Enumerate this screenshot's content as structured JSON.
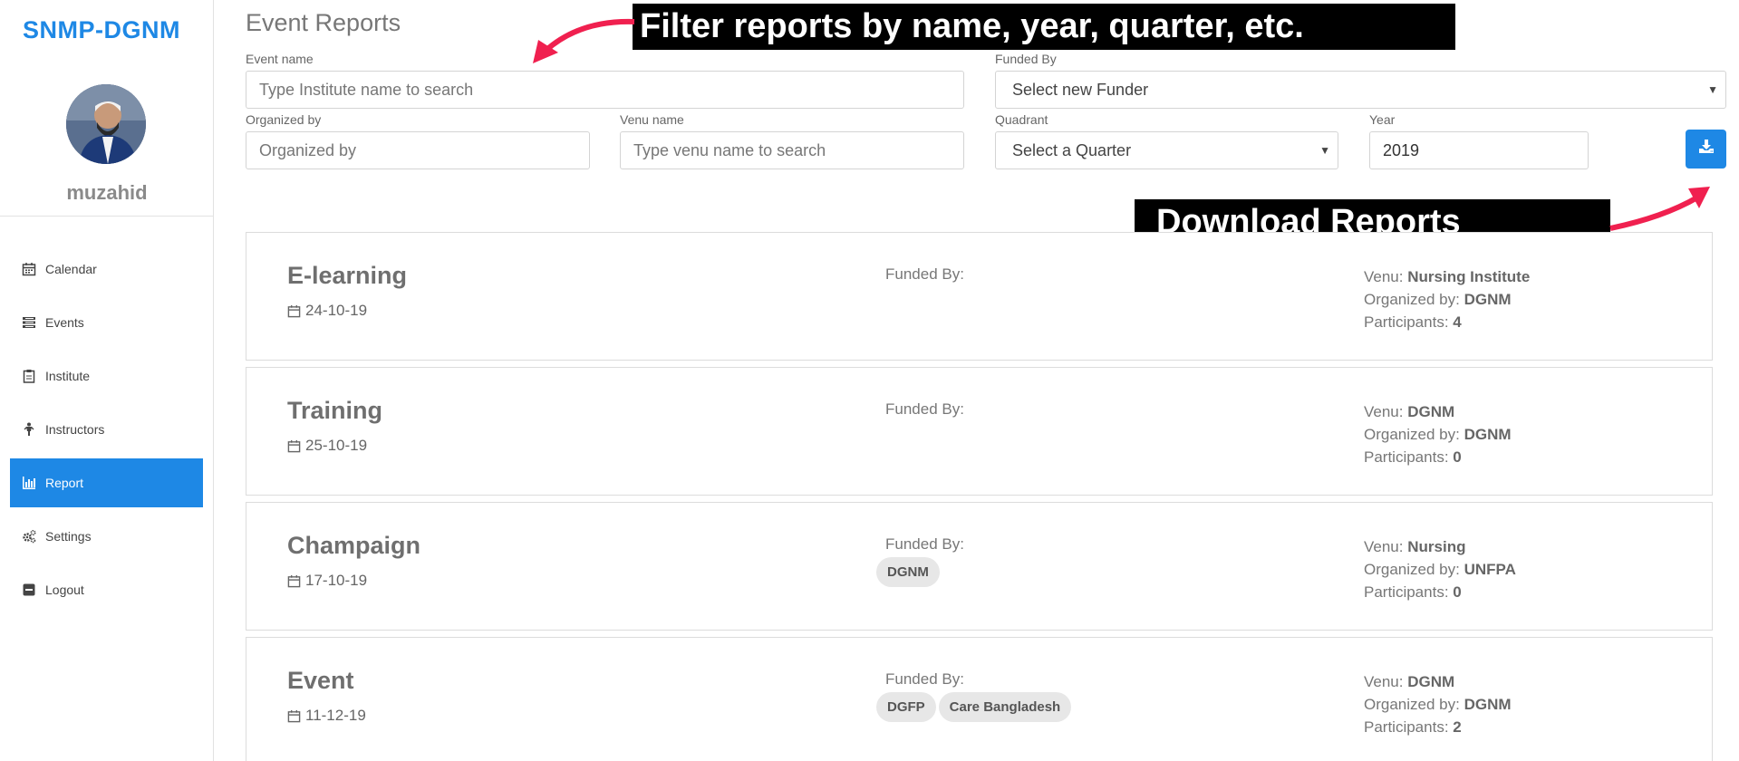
{
  "app": {
    "brand": "SNMP-DGNM",
    "username": "muzahid"
  },
  "sidebar": {
    "items": [
      {
        "label": "Calendar",
        "icon": "calendar-icon"
      },
      {
        "label": "Events",
        "icon": "list-icon"
      },
      {
        "label": "Institute",
        "icon": "clipboard-icon"
      },
      {
        "label": "Instructors",
        "icon": "person-icon"
      },
      {
        "label": "Report",
        "icon": "bar-chart-icon",
        "active": true
      },
      {
        "label": "Settings",
        "icon": "gears-icon"
      },
      {
        "label": "Logout",
        "icon": "logout-icon"
      }
    ]
  },
  "page": {
    "title": "Event Reports"
  },
  "filters": {
    "event_name": {
      "label": "Event name",
      "placeholder": "Type Institute name to search",
      "value": ""
    },
    "funded_by": {
      "label": "Funded By",
      "selected": "Select new Funder"
    },
    "organized_by": {
      "label": "Organized by",
      "placeholder": "Organized by",
      "value": ""
    },
    "venue_name": {
      "label": "Venu name",
      "placeholder": "Type venu name to search",
      "value": ""
    },
    "quadrant": {
      "label": "Quadrant",
      "selected": "Select a Quarter"
    },
    "year": {
      "label": "Year",
      "value": "2019"
    }
  },
  "annotations": {
    "filter": "Filter reports by name, year, quarter, etc.",
    "download": "Download Reports",
    "color": "#f0204f"
  },
  "events": [
    {
      "title": "E-learning",
      "date": "24-10-19",
      "funded_label": "Funded By:",
      "funders": [],
      "venue_label": "Venu:",
      "venue": "Nursing Institute",
      "organized_label": "Organized by:",
      "organized": "DGNM",
      "participants_label": "Participants:",
      "participants": "4"
    },
    {
      "title": "Training",
      "date": "25-10-19",
      "funded_label": "Funded By:",
      "funders": [],
      "venue_label": "Venu:",
      "venue": "DGNM",
      "organized_label": "Organized by:",
      "organized": "DGNM",
      "participants_label": "Participants:",
      "participants": "0"
    },
    {
      "title": "Champaign",
      "date": "17-10-19",
      "funded_label": "Funded By:",
      "funders": [
        "DGNM"
      ],
      "venue_label": "Venu:",
      "venue": "Nursing",
      "organized_label": "Organized by:",
      "organized": "UNFPA",
      "participants_label": "Participants:",
      "participants": "0"
    },
    {
      "title": "Event",
      "date": "11-12-19",
      "funded_label": "Funded By:",
      "funders": [
        "DGFP",
        "Care Bangladesh"
      ],
      "venue_label": "Venu:",
      "venue": "DGNM",
      "organized_label": "Organized by:",
      "organized": "DGNM",
      "participants_label": "Participants:",
      "participants": "2"
    }
  ],
  "colors": {
    "primary": "#1e88e5",
    "annotation": "#f0204f"
  }
}
